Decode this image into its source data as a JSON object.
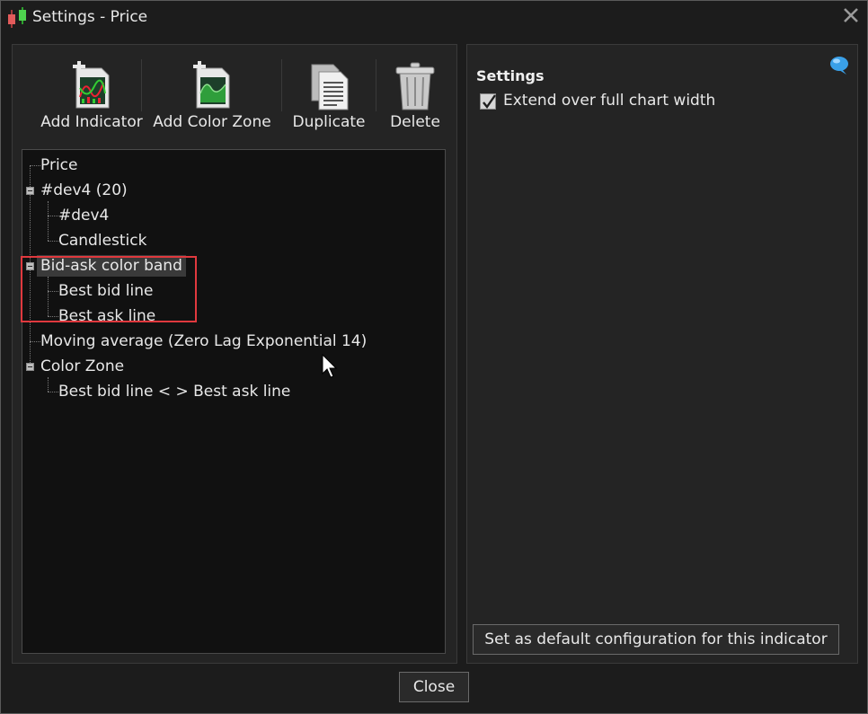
{
  "window": {
    "title": "Settings - Price"
  },
  "toolbar": {
    "add_indicator": "Add Indicator",
    "add_color_zone": "Add Color Zone",
    "duplicate": "Duplicate",
    "delete": "Delete"
  },
  "tree": {
    "price": "Price",
    "dev4_group": "#dev4 (20)",
    "dev4_child": "#dev4",
    "candlestick": "Candlestick",
    "bid_ask_band": "Bid-ask color band",
    "best_bid": "Best bid line",
    "best_ask": "Best ask line",
    "moving_average": "Moving average (Zero Lag Exponential 14)",
    "color_zone": "Color Zone",
    "color_zone_child": "Best bid line < > Best ask line"
  },
  "settings": {
    "heading": "Settings",
    "extend_label": "Extend over full chart width",
    "extend_checked": true,
    "default_button": "Set as default configuration for this indicator"
  },
  "footer": {
    "close": "Close"
  },
  "colors": {
    "highlight_box": "#e0393e",
    "panel_bg": "#242424",
    "tree_bg": "#111111"
  }
}
